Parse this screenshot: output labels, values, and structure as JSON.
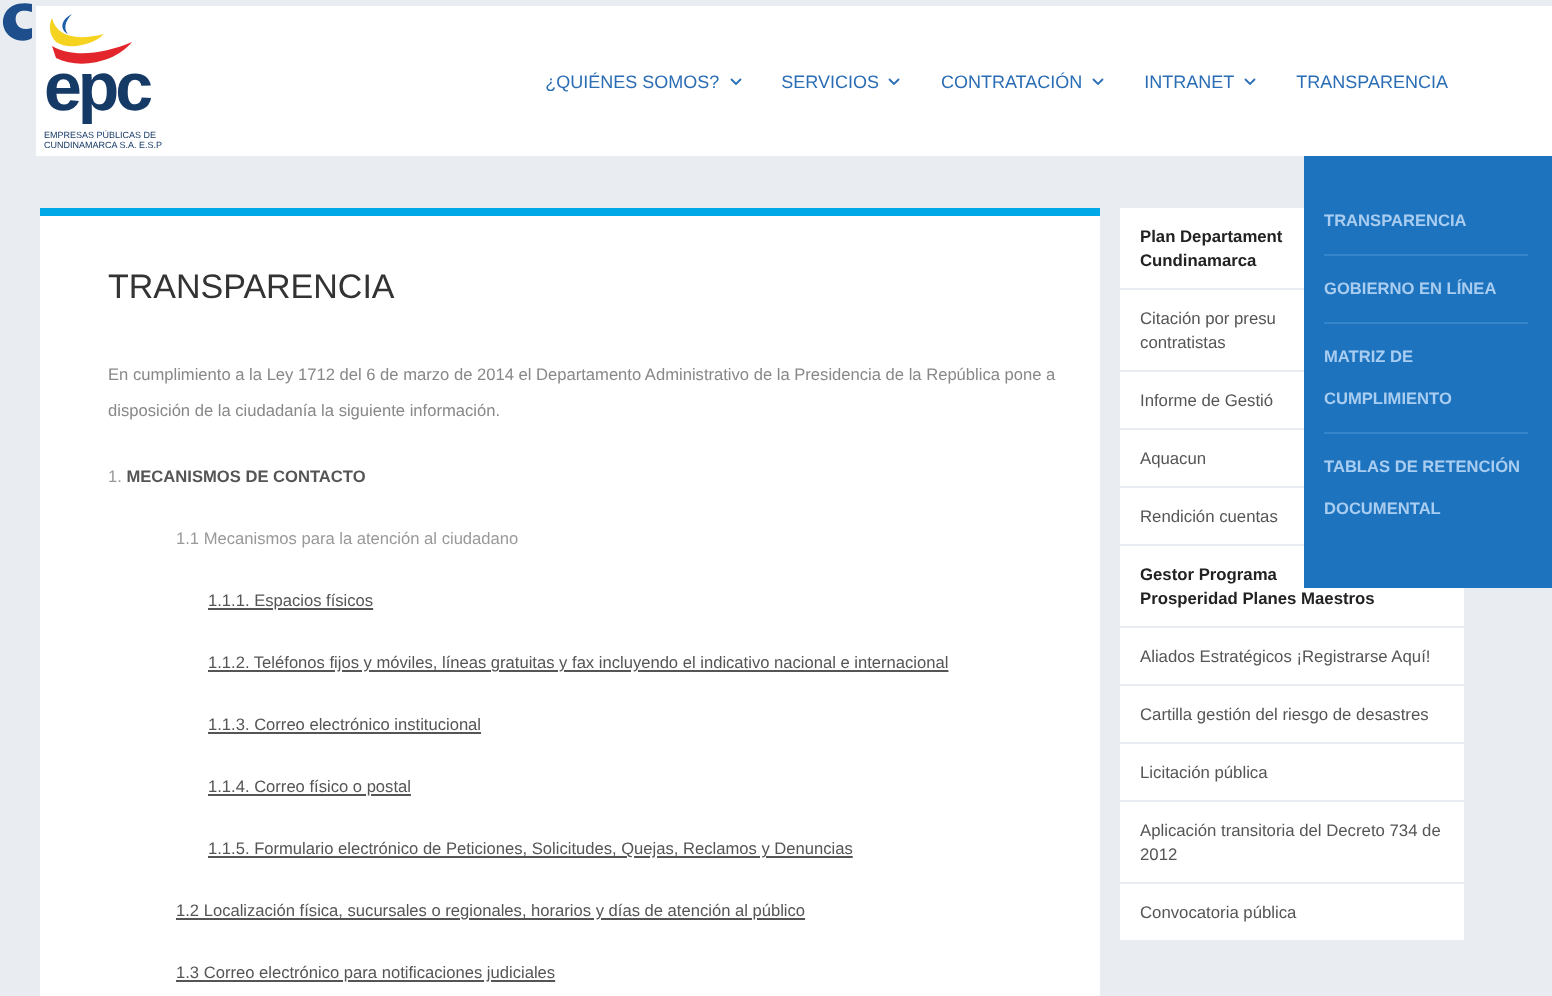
{
  "logo": {
    "mark": "epc",
    "caption": [
      "EMPRESAS PÚBLICAS DE",
      "CUNDINAMARCA S.A. E.S.P"
    ]
  },
  "nav": [
    {
      "label": "¿QUIÉNES SOMOS?",
      "has_menu": true
    },
    {
      "label": "SERVICIOS",
      "has_menu": true
    },
    {
      "label": "CONTRATACIÓN",
      "has_menu": true
    },
    {
      "label": "INTRANET",
      "has_menu": true
    },
    {
      "label": "TRANSPARENCIA",
      "has_menu": false
    }
  ],
  "dropdown": [
    "TRANSPARENCIA",
    "GOBIERNO EN LÍNEA",
    "MATRIZ DE CUMPLIMIENTO",
    "TABLAS DE RETENCIÓN DOCUMENTAL"
  ],
  "page": {
    "title": "TRANSPARENCIA",
    "intro": "En cumplimiento a la Ley 1712 del 6 de marzo de 2014 el Departamento Administrativo de la Presidencia de la República pone a disposición de la ciudadanía la siguiente información.",
    "sections": [
      {
        "text": "1. **MECANISMOS DE CONTACTO**",
        "kind": "heading",
        "children": [
          {
            "text": "1.1 Mecanismos para la atención al ciudadano",
            "kind": "text",
            "children": [
              {
                "text": "1.1.1. Espacios físicos",
                "kind": "link"
              },
              {
                "text": "1.1.2. Teléfonos fijos y móviles, líneas gratuitas y fax incluyendo el indicativo nacional e internacional",
                "kind": "link"
              },
              {
                "text": "1.1.3. Correo electrónico institucional",
                "kind": "link"
              },
              {
                "text": "1.1.4. Correo físico o postal",
                "kind": "link"
              },
              {
                "text": "1.1.5. Formulario electrónico de Peticiones, Solicitudes, Quejas, Reclamos y Denuncias",
                "kind": "link"
              }
            ]
          },
          {
            "text": "1.2 Localización física, sucursales o regionales, horarios y días de atención al público",
            "kind": "link"
          },
          {
            "text": "1.3 Correo electrónico para notificaciones judiciales",
            "kind": "link"
          }
        ]
      }
    ]
  },
  "sidebar": [
    {
      "text": "Plan Departament\nCundinamarca",
      "kind": "featured"
    },
    {
      "text": "Citación por presu\ncontratistas",
      "kind": "normal"
    },
    {
      "text": "Informe de Gestió",
      "kind": "normal"
    },
    {
      "text": "Aquacun",
      "kind": "normal"
    },
    {
      "text": "Rendición cuentas",
      "kind": "normal"
    },
    {
      "text": "Gestor Programa\nProsperidad Planes Maestros",
      "kind": "featured"
    },
    {
      "text": "Aliados Estratégicos ¡Registrarse Aquí!",
      "kind": "normal"
    },
    {
      "text": "Cartilla gestión del riesgo de desastres",
      "kind": "normal"
    },
    {
      "text": "Licitación pública",
      "kind": "normal"
    },
    {
      "text": "Aplicación transitoria del Decreto 734 de 2012",
      "kind": "normal"
    },
    {
      "text": "Convocatoria pública",
      "kind": "normal"
    }
  ]
}
